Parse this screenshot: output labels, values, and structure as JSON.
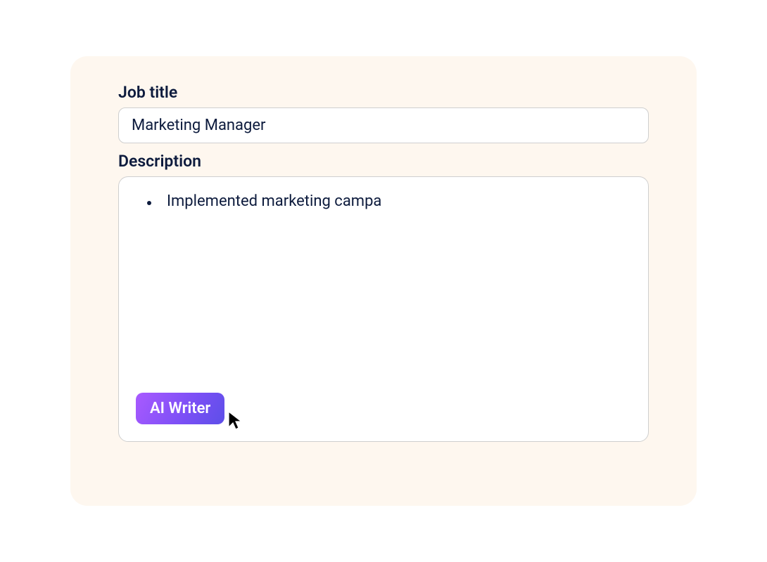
{
  "form": {
    "job_title_label": "Job title",
    "job_title_value": "Marketing Manager",
    "description_label": "Description",
    "description_bullets": [
      "Implemented marketing campa"
    ],
    "ai_writer_button_label": "AI Writer"
  }
}
